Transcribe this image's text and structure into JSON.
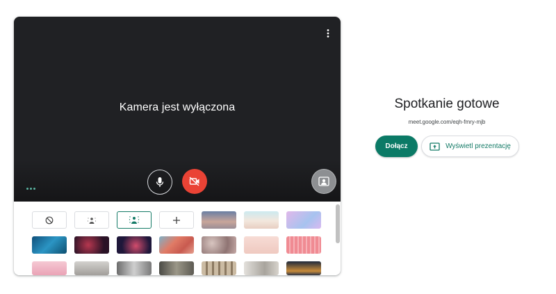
{
  "preview": {
    "camera_off_text": "Kamera jest wyłączona",
    "more_icon": "more-vert-icon",
    "mic_icon": "microphone-icon",
    "camera_off_icon": "videocam-off-icon",
    "effects_icon": "visual-effects-icon"
  },
  "backgrounds": {
    "options": [
      {
        "name": "no-effect",
        "icon": "block-icon"
      },
      {
        "name": "slight-blur",
        "icon": "blur-icon"
      },
      {
        "name": "blur",
        "icon": "blur-icon",
        "selected": true
      },
      {
        "name": "upload",
        "icon": "plus-icon"
      }
    ],
    "image_colors": [
      "#8d8a97",
      "#e7d8cf",
      "#bfa8e6",
      "#1f7ca8",
      "#4b1d36",
      "#2a1a3a",
      "#d68b7b",
      "#9b8583",
      "#f0d0c8",
      "#f08a92",
      "#f0b7c4",
      "#b9b6b2",
      "#8a8a8a",
      "#6d6a62",
      "#b6aa96",
      "#c5c2bd",
      "#243142"
    ]
  },
  "panel": {
    "title": "Spotkanie gotowe",
    "meeting_link": "meet.google.com/eqh-fmry-mjb",
    "join_label": "Dołącz",
    "present_label": "Wyświetl prezentację",
    "present_icon": "present-to-all-icon"
  },
  "colors": {
    "accent": "#0b7a66",
    "camera_off_red": "#ea4335",
    "preview_bg": "#202124"
  }
}
